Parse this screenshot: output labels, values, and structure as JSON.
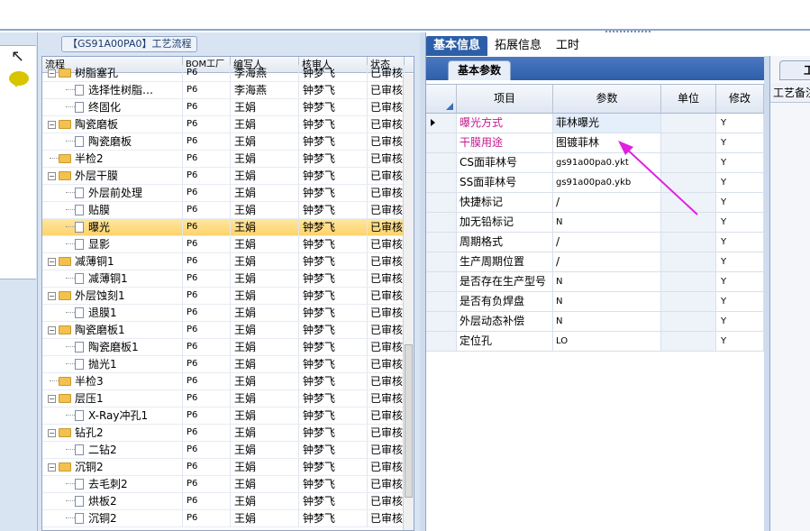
{
  "left_panel": {
    "title": "【GS91A00PA0】工艺流程",
    "columns": [
      "流程",
      "BOM工厂",
      "编写人",
      "核审人",
      "状态"
    ],
    "rows": [
      {
        "label": "树脂塞孔",
        "indent": 1,
        "kind": "folder",
        "bom": "P6",
        "writer": "李海燕",
        "checker": "钟梦飞",
        "status": "已审核"
      },
      {
        "label": "选择性树脂…",
        "indent": 2,
        "kind": "doc",
        "bom": "P6",
        "writer": "李海燕",
        "checker": "钟梦飞",
        "status": "已审核"
      },
      {
        "label": "终固化",
        "indent": 2,
        "kind": "doc",
        "bom": "P6",
        "writer": "王娟",
        "checker": "钟梦飞",
        "status": "已审核"
      },
      {
        "label": "陶瓷磨板",
        "indent": 1,
        "kind": "folder",
        "bom": "P6",
        "writer": "王娟",
        "checker": "钟梦飞",
        "status": "已审核"
      },
      {
        "label": "陶瓷磨板",
        "indent": 2,
        "kind": "doc",
        "bom": "P6",
        "writer": "王娟",
        "checker": "钟梦飞",
        "status": "已审核"
      },
      {
        "label": "半检2",
        "indent": 1,
        "kind": "folder-leaf",
        "bom": "P6",
        "writer": "王娟",
        "checker": "钟梦飞",
        "status": "已审核"
      },
      {
        "label": "外层干膜",
        "indent": 1,
        "kind": "folder",
        "bom": "P6",
        "writer": "王娟",
        "checker": "钟梦飞",
        "status": "已审核"
      },
      {
        "label": "外层前处理",
        "indent": 2,
        "kind": "doc",
        "bom": "P6",
        "writer": "王娟",
        "checker": "钟梦飞",
        "status": "已审核"
      },
      {
        "label": "贴膜",
        "indent": 2,
        "kind": "doc",
        "bom": "P6",
        "writer": "王娟",
        "checker": "钟梦飞",
        "status": "已审核"
      },
      {
        "label": "曝光",
        "indent": 2,
        "kind": "doc",
        "bom": "P6",
        "writer": "王娟",
        "checker": "钟梦飞",
        "status": "已审核",
        "selected": true
      },
      {
        "label": "显影",
        "indent": 2,
        "kind": "doc",
        "bom": "P6",
        "writer": "王娟",
        "checker": "钟梦飞",
        "status": "已审核"
      },
      {
        "label": "减薄铜1",
        "indent": 1,
        "kind": "folder",
        "bom": "P6",
        "writer": "王娟",
        "checker": "钟梦飞",
        "status": "已审核"
      },
      {
        "label": "减薄铜1",
        "indent": 2,
        "kind": "doc",
        "bom": "P6",
        "writer": "王娟",
        "checker": "钟梦飞",
        "status": "已审核"
      },
      {
        "label": "外层蚀刻1",
        "indent": 1,
        "kind": "folder",
        "bom": "P6",
        "writer": "王娟",
        "checker": "钟梦飞",
        "status": "已审核"
      },
      {
        "label": "退膜1",
        "indent": 2,
        "kind": "doc",
        "bom": "P6",
        "writer": "王娟",
        "checker": "钟梦飞",
        "status": "已审核"
      },
      {
        "label": "陶瓷磨板1",
        "indent": 1,
        "kind": "folder",
        "bom": "P6",
        "writer": "王娟",
        "checker": "钟梦飞",
        "status": "已审核"
      },
      {
        "label": "陶瓷磨板1",
        "indent": 2,
        "kind": "doc",
        "bom": "P6",
        "writer": "王娟",
        "checker": "钟梦飞",
        "status": "已审核"
      },
      {
        "label": "抛光1",
        "indent": 2,
        "kind": "doc",
        "bom": "P6",
        "writer": "王娟",
        "checker": "钟梦飞",
        "status": "已审核"
      },
      {
        "label": "半检3",
        "indent": 1,
        "kind": "folder-leaf",
        "bom": "P6",
        "writer": "王娟",
        "checker": "钟梦飞",
        "status": "已审核"
      },
      {
        "label": "层压1",
        "indent": 1,
        "kind": "folder",
        "bom": "P6",
        "writer": "王娟",
        "checker": "钟梦飞",
        "status": "已审核"
      },
      {
        "label": "X-Ray冲孔1",
        "indent": 2,
        "kind": "doc",
        "bom": "P6",
        "writer": "王娟",
        "checker": "钟梦飞",
        "status": "已审核"
      },
      {
        "label": "钻孔2",
        "indent": 1,
        "kind": "folder",
        "bom": "P6",
        "writer": "王娟",
        "checker": "钟梦飞",
        "status": "已审核"
      },
      {
        "label": "二钻2",
        "indent": 2,
        "kind": "doc",
        "bom": "P6",
        "writer": "王娟",
        "checker": "钟梦飞",
        "status": "已审核"
      },
      {
        "label": "沉铜2",
        "indent": 1,
        "kind": "folder",
        "bom": "P6",
        "writer": "王娟",
        "checker": "钟梦飞",
        "status": "已审核"
      },
      {
        "label": "去毛刺2",
        "indent": 2,
        "kind": "doc",
        "bom": "P6",
        "writer": "王娟",
        "checker": "钟梦飞",
        "status": "已审核"
      },
      {
        "label": "烘板2",
        "indent": 2,
        "kind": "doc",
        "bom": "P6",
        "writer": "王娟",
        "checker": "钟梦飞",
        "status": "已审核"
      },
      {
        "label": "沉铜2",
        "indent": 2,
        "kind": "doc",
        "bom": "P6",
        "writer": "王娟",
        "checker": "钟梦飞",
        "status": "已审核"
      }
    ]
  },
  "right_panel": {
    "tabs": [
      "基本信息",
      "拓展信息",
      "工时"
    ],
    "active_tab": 0,
    "sub_tab": "基本参数",
    "columns": {
      "item": "项目",
      "param": "参数",
      "unit": "单位",
      "modify": "修改"
    },
    "rows": [
      {
        "item": "曝光方式",
        "param": "菲林曝光",
        "unit": "",
        "modify": "Y",
        "pink": true,
        "current": true,
        "small": false
      },
      {
        "item": "干膜用途",
        "param": "图镀菲林",
        "unit": "",
        "modify": "Y",
        "pink": true,
        "small": false
      },
      {
        "item": "CS面菲林号",
        "param": "gs91a00pa0.ykt",
        "unit": "",
        "modify": "Y",
        "small": true
      },
      {
        "item": "SS面菲林号",
        "param": "gs91a00pa0.ykb",
        "unit": "",
        "modify": "Y",
        "small": true
      },
      {
        "item": "快捷标记",
        "param": "/",
        "unit": "",
        "modify": "Y",
        "small": false
      },
      {
        "item": "加无铅标记",
        "param": "N",
        "unit": "",
        "modify": "Y",
        "small": true
      },
      {
        "item": "周期格式",
        "param": "/",
        "unit": "",
        "modify": "Y",
        "small": false
      },
      {
        "item": "生产周期位置",
        "param": "/",
        "unit": "",
        "modify": "Y",
        "small": false
      },
      {
        "item": "是否存在生产型号",
        "param": "N",
        "unit": "",
        "modify": "Y",
        "small": true
      },
      {
        "item": "是否有负焊盘",
        "param": "N",
        "unit": "",
        "modify": "Y",
        "small": true
      },
      {
        "item": "外层动态补偿",
        "param": "N",
        "unit": "",
        "modify": "Y",
        "small": true
      },
      {
        "item": "定位孔",
        "param": "LO",
        "unit": "",
        "modify": "Y",
        "small": true
      }
    ]
  },
  "far_panel": {
    "tab": "工",
    "header": "工艺备注"
  },
  "colors": {
    "accent": "#2d5fa8",
    "pink_text": "#c21a8e",
    "selection": "#ffd36b",
    "annotation_arrow": "#e020e0"
  }
}
